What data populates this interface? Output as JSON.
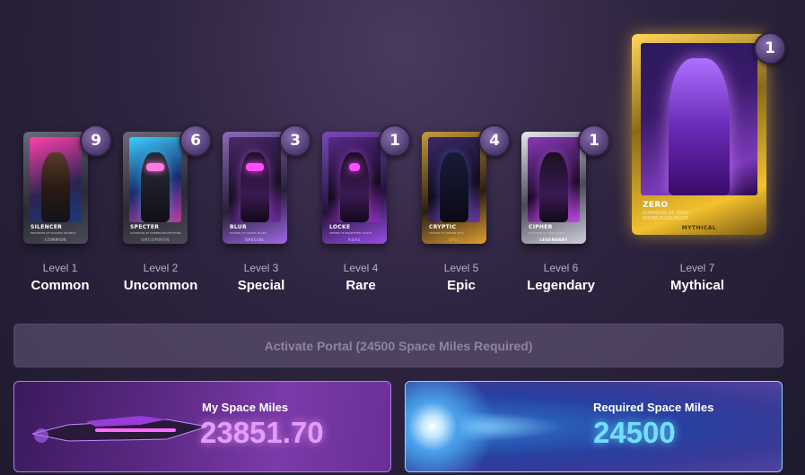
{
  "cards": [
    {
      "name": "SILENCER",
      "sub": "ENFORCER OF SHADOW SECRECY",
      "rarity": "COMMON",
      "level": "Level 1",
      "tier": "Common",
      "count": "9",
      "accent": "#9a9aa8"
    },
    {
      "name": "SPECTER",
      "sub": "GUARDIAN OF UNSEEN PROTECTIONS",
      "rarity": "UNCOMMON",
      "level": "Level 2",
      "tier": "Uncommon",
      "count": "6",
      "accent": "#8a8a9a"
    },
    {
      "name": "BLUR",
      "sub": "MASTER OF DIGITAL BLURS",
      "rarity": "SPECIAL",
      "level": "Level 3",
      "tier": "Special",
      "count": "3",
      "accent": "#b070ff"
    },
    {
      "name": "LOCKE",
      "sub": "KEEPER OF ENCRYPTED VAULTS",
      "rarity": "RARE",
      "level": "Level 4",
      "tier": "Rare",
      "count": "1",
      "accent": "#9d4de8"
    },
    {
      "name": "CRYPTIC",
      "sub": "MASTER OF HIDDEN KEYS",
      "rarity": "EPIC",
      "level": "Level 5",
      "tier": "Epic",
      "count": "4",
      "accent": "#e0a030"
    },
    {
      "name": "CIPHER",
      "sub": "DECODER OF DARK CODES",
      "rarity": "LEGENDARY",
      "level": "Level 6",
      "tier": "Legendary",
      "count": "1",
      "accent": "#d8d8e0"
    },
    {
      "name": "ZERO",
      "sub": "GUARDIAN OF ZERO-KNOWLEDGE PROOF",
      "rarity": "MYTHICAL",
      "level": "Level 7",
      "tier": "Mythical",
      "count": "1",
      "accent": "#f2c12e"
    }
  ],
  "activate_label": "Activate Portal (24500 Space Miles Required)",
  "my_miles": {
    "title": "My Space Miles",
    "value": "23851.70"
  },
  "required_miles": {
    "title": "Required Space Miles",
    "value": "24500"
  },
  "colors": {
    "my_value": "#e79bff",
    "required_value": "#6fe0ff",
    "gold": "#f2c12e"
  }
}
